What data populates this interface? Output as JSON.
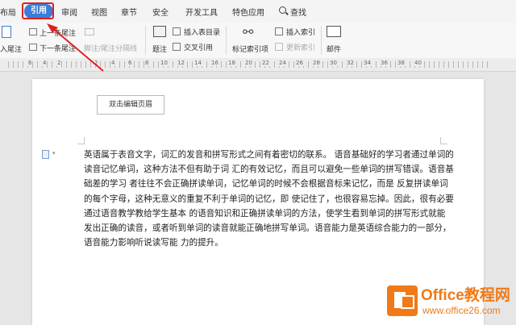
{
  "tabs": [
    {
      "label": "布局"
    },
    {
      "label": "引用"
    },
    {
      "label": "审阅"
    },
    {
      "label": "视图"
    },
    {
      "label": "章节"
    },
    {
      "label": "安全"
    },
    {
      "label": "开发工具"
    },
    {
      "label": "特色应用"
    }
  ],
  "active_tab_index": 1,
  "search_label": "查找",
  "ribbon": {
    "insert_footnote": "入尾注",
    "prev_footnote": "上一条尾注",
    "next_footnote": "下一条尾注",
    "footnote_separator": "脚注/尾注分隔线",
    "caption": "题注",
    "insert_table_of_figures": "插入表目录",
    "cross_reference": "交叉引用",
    "mark_index_entry": "标记索引项",
    "insert_index": "插入索引",
    "update_index": "更新索引",
    "mail": "邮件"
  },
  "ruler_numbers": [
    "6",
    "4",
    "2",
    "2",
    "4",
    "6",
    "8",
    "10",
    "12",
    "14",
    "16",
    "18",
    "20",
    "22",
    "24",
    "26",
    "28",
    "30",
    "32",
    "34",
    "36",
    "38",
    "40"
  ],
  "header_tip": "双击编辑页眉",
  "document_text": "英语属于表音文字，词汇的发音和拼写形式之间有着密切的联系。 语音基础好的学习者通过单词的读音记忆单词，这种方法不但有助于词 汇的有效记忆，而且可以避免一些单词的拼写错误。语音基础差的学习 者往往不会正确拼读单词，记忆单词的时候不会根据音标来记忆，而是 反复拼读单词的每个字母，这种无意义的重复不利于单词的记忆，即 使记住了，也很容易忘掉。因此，很有必要通过语音教学教给学生基本 的语音知识和正确拼读单词的方法，使学生看到单词的拼写形式就能 发出正确的读音，或者听到单词的读音就能正确地拼写单词。语音能力是英语综合能力的一部分，语音能力影响听说读写能 力的提升。",
  "watermark": {
    "title": "Office教程网",
    "url": "www.office26.com"
  },
  "colors": {
    "accent": "#3b7dd8",
    "highlight": "#e02020",
    "brand": "#f07a18"
  }
}
